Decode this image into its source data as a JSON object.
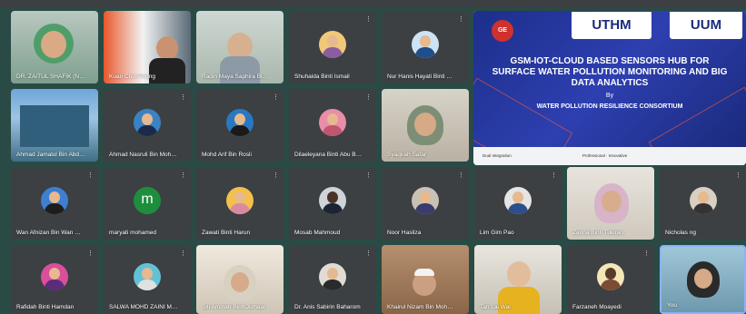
{
  "participants": [
    {
      "name": "DR. ZAITUL SHAFIK (NAHRIM)",
      "kind": "video"
    },
    {
      "name": "Kuan Chin Phong",
      "kind": "video"
    },
    {
      "name": "Radin Maya Saphira Binti Ra...",
      "kind": "video"
    },
    {
      "name": "Shuhaida Binti Ismail",
      "kind": "avatar"
    },
    {
      "name": "Nur Hanis Hayati Binti Hairom",
      "kind": "avatar"
    },
    {
      "name": "Ahmad Jamalul Bin Abd Kari...",
      "kind": "video"
    },
    {
      "name": "Ahmad Nasruli Bin Mohamed",
      "kind": "avatar"
    },
    {
      "name": "Mohd Arif Bin Rosli",
      "kind": "avatar"
    },
    {
      "name": "Dilaeleyana Binti Abu Bakar ...",
      "kind": "avatar"
    },
    {
      "name": "Syaqirah Safar",
      "kind": "video"
    },
    {
      "name": "Wan Afnizan Bin Wan Moha...",
      "kind": "avatar"
    },
    {
      "name": "maryati mohamed",
      "kind": "letter",
      "letter": "m"
    },
    {
      "name": "Zawati Binti Harun",
      "kind": "avatar"
    },
    {
      "name": "Mosab Mahmoud",
      "kind": "avatar"
    },
    {
      "name": "Noor Hasliza",
      "kind": "avatar"
    },
    {
      "name": "Lim Gim Pao",
      "kind": "avatar"
    },
    {
      "name": "Zarina Binti Tukiran",
      "kind": "video"
    },
    {
      "name": "Nicholas ng",
      "kind": "avatar"
    },
    {
      "name": "Rafidah Binti Hamdan",
      "kind": "avatar"
    },
    {
      "name": "SALWA MOHD ZAINI MAKHT...",
      "kind": "avatar"
    },
    {
      "name": "Siti Aminah Binti Jumaat",
      "kind": "video"
    },
    {
      "name": "Dr. Anis Sabirin Baharom",
      "kind": "avatar"
    },
    {
      "name": "Khairul Nizam Bin Mohd Yu...",
      "kind": "video"
    },
    {
      "name": "Tan Lai Wai",
      "kind": "video"
    },
    {
      "name": "Farzaneh Moayedi",
      "kind": "avatar"
    },
    {
      "name": "You",
      "kind": "video"
    }
  ],
  "slide": {
    "badge": "GE",
    "logo_left": "UTHM",
    "logo_right": "UUM",
    "title": "GSM-IOT-CLOUD BASED SENSORS HUB FOR SURFACE WATER POLLUTION MONITORING AND BIG DATA ANALYTICS",
    "by": "By",
    "org": "WATER POLLUTION RESILIENCE CONSORTIUM",
    "footer_left": "Dual Integration",
    "footer_mid": "Professional · Innovative"
  },
  "colors": {
    "background": "#2a4a45",
    "tile": "#3c4043",
    "slide_blue": "#1c2f8a",
    "avatar_letter": "#1e8e3e"
  },
  "icons": {
    "tile_menu": "mic-off-icon"
  }
}
